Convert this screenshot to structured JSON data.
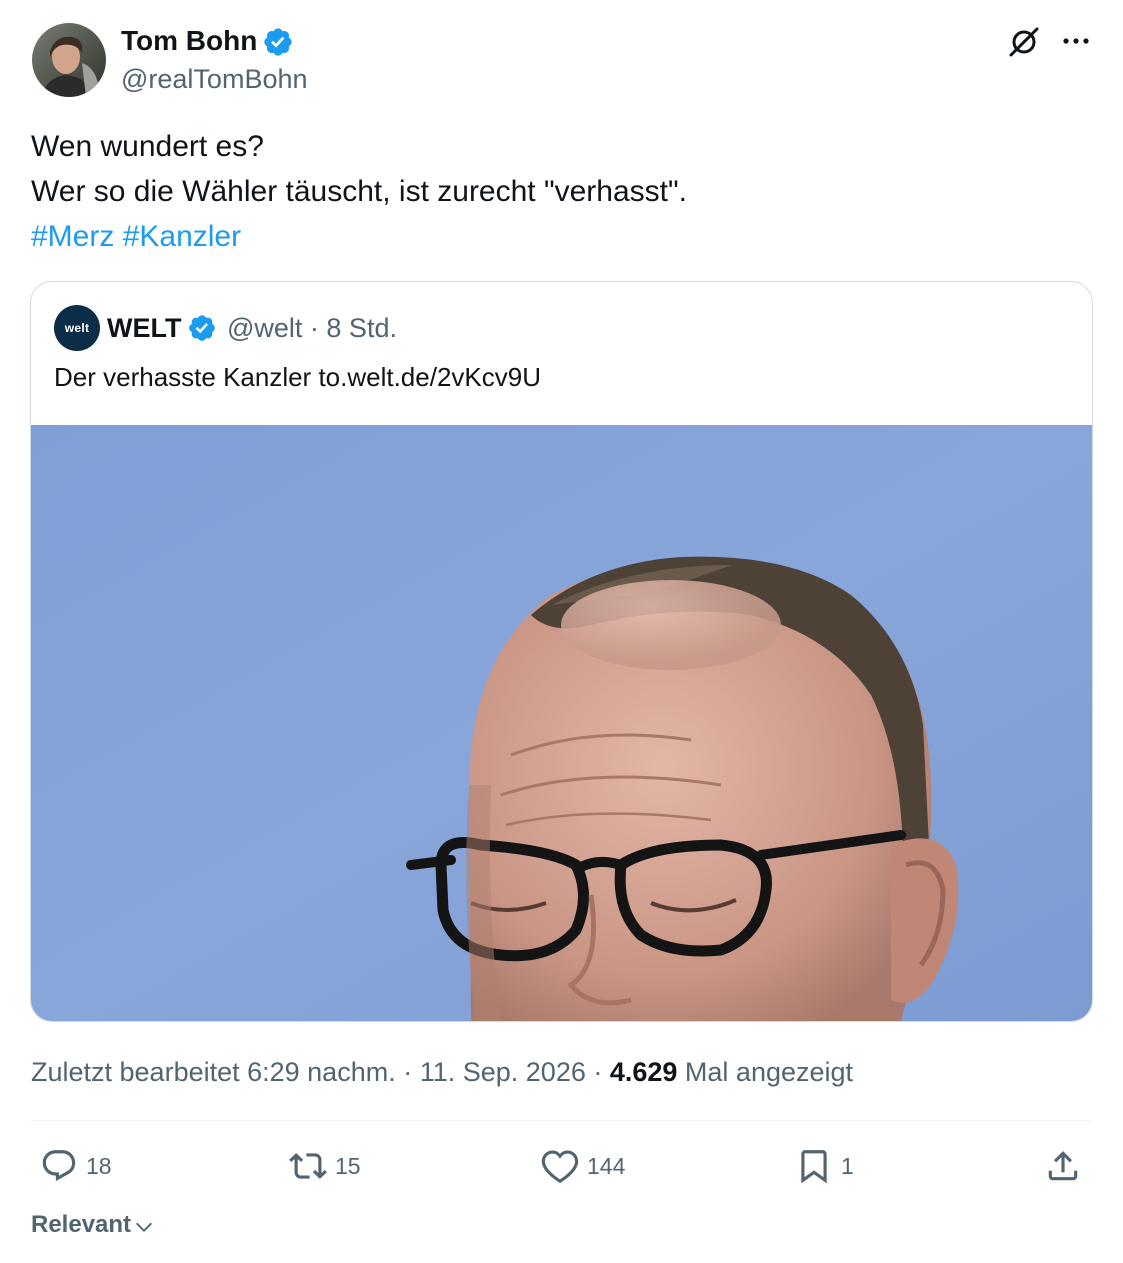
{
  "author": {
    "name": "Tom Bohn",
    "handle": "@realTomBohn"
  },
  "tweet": {
    "line1": "Wen wundert es?",
    "line2": "Wer so die Wähler täuscht, ist zurecht \"verhasst\".",
    "hashtags": [
      "#Merz",
      "#Kanzler"
    ]
  },
  "quote": {
    "avatar_text": "welt",
    "name": "WELT",
    "handle_time": "@welt · 8 Std.",
    "text": "Der verhasste Kanzler to.welt.de/2vKcv9U"
  },
  "meta": {
    "edited": "Zuletzt bearbeitet 6:29 nachm. · 11. Sep. 2026 · ",
    "views_count": "4.629",
    "views_label": " Mal angezeigt"
  },
  "actions": {
    "reply_count": "18",
    "retweet_count": "15",
    "like_count": "144",
    "bookmark_count": "1"
  },
  "sort": {
    "label": "Relevant"
  },
  "colors": {
    "accent": "#1d9bf0",
    "muted": "#536471",
    "text": "#0f1419"
  },
  "icons": [
    "verified-badge-icon",
    "grok-icon",
    "more-icon",
    "reply-icon",
    "retweet-icon",
    "like-icon",
    "bookmark-icon",
    "share-icon",
    "chevron-down-icon"
  ]
}
